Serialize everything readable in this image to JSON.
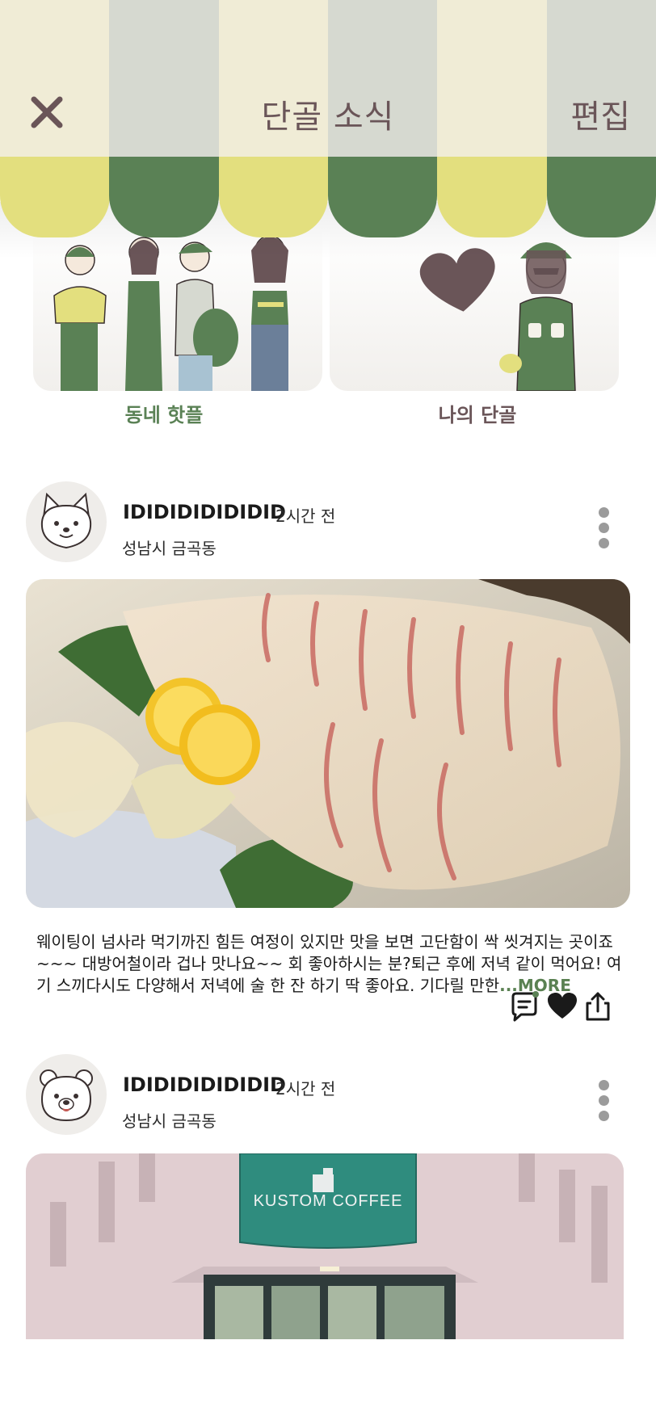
{
  "header": {
    "title": "단골 소식",
    "edit_label": "편집",
    "stripe_colors": {
      "upper_light": "#f0ecd6",
      "upper_dark": "#d6d9d0",
      "lower_yellow": "#e3df7e",
      "lower_green": "#5a8155"
    }
  },
  "categories": [
    {
      "label": "동네 핫플",
      "color": "#5a8155"
    },
    {
      "label": "나의 단골",
      "color": "#6a5558"
    }
  ],
  "posts": [
    {
      "username": "IDIDIDIDIDIDID",
      "time": "2시간 전",
      "location": "성남시 금곡동",
      "avatar": "fox-avatar-icon",
      "image": "sashimi-photo",
      "text": "웨이팅이 넘사라 먹기까진 힘든 여정이 있지만 맛을 보면 고단함이 싹 씻겨지는 곳이죠~~~ 대방어철이라 겁나 맛나요~~ 회 좋아하시는 분?퇴근 후에 저녁 같이 먹어요! 여기 스끼다시도 다양해서 저녁에 술 한 잔 하기 딱 좋아요. 기다릴 만한",
      "more_label": "...MORE",
      "actions": [
        "comment-icon",
        "heart-icon",
        "share-icon"
      ]
    },
    {
      "username": "IDIDIDIDIDIDID",
      "time": "2시간 전",
      "location": "성남시 금곡동",
      "avatar": "bear-avatar-icon",
      "image": "cafe-storefront-photo",
      "sign_text": "KUSTOM COFFEE"
    }
  ]
}
